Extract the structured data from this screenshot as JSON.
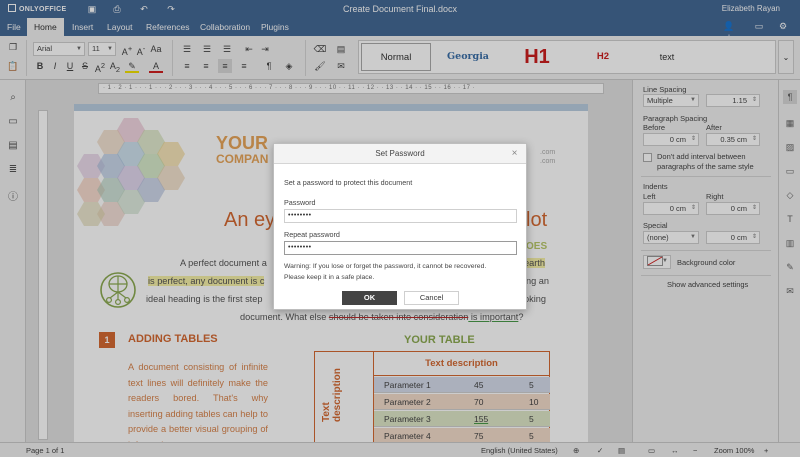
{
  "app": {
    "logo": "ONLYOFFICE",
    "doc_title": "Create Document Final.docx",
    "user": "Elizabeth Rayan"
  },
  "tabs": [
    {
      "label": "File"
    },
    {
      "label": "Home"
    },
    {
      "label": "Insert"
    },
    {
      "label": "Layout"
    },
    {
      "label": "References"
    },
    {
      "label": "Collaboration"
    },
    {
      "label": "Plugins"
    }
  ],
  "toolbar": {
    "font_name": "Arial",
    "font_size": "11",
    "bold": "B",
    "italic": "I",
    "underline": "U",
    "strike": "S",
    "superscript": "A",
    "subscript": "A",
    "font_color": "A"
  },
  "styles": [
    {
      "label": "Normal"
    },
    {
      "label": "Georgia"
    },
    {
      "label": "H1"
    },
    {
      "label": "H2"
    },
    {
      "label": "text"
    }
  ],
  "ruler": {
    "numbers": "· 1 · 2 · 1 · · · 1 · · · 2 · · · 3 · · · 4 · · · 5 · · · 6 · · · 7 · · · 8 · · · 9 · · · 10 · · 11 · · 12 · · 13 · · 14 · · 15 · · 16 · · 17 ·"
  },
  "document": {
    "company_l1": "YOUR",
    "company_l2": "COMPAN",
    "contact_l1": ".com",
    "contact_l2": ".com",
    "heading_left": "An ey",
    "heading_right": "lot",
    "oes": "OES",
    "p1_a": "A perfect document a",
    "p1_b": "earth",
    "p2_a": "is perfect, any document is c",
    "p2_b": "ng an",
    "p3_a": "ideal heading is the first step",
    "p3_b": "oking",
    "p4_a": "document. What else ",
    "p4_strike": "should be taken into consideration",
    "p4_b": " is important",
    "p4_c": "?",
    "section_number": "1",
    "section_title": "ADDING TABLES",
    "section_text": "A document consisting of infinite text lines will definitely make the readers bored. That's why inserting adding tables can help to provide a better visual grouping of information.",
    "table_title": "YOUR TABLE",
    "table_header": "Text description",
    "table_side": "Text description",
    "rows": [
      {
        "name": "Parameter 1",
        "v1": "45",
        "v2": "5"
      },
      {
        "name": "Parameter 2",
        "v1": "70",
        "v2": "10"
      },
      {
        "name": "Parameter 3",
        "v1": "155",
        "v2": "5"
      },
      {
        "name": "Parameter 4",
        "v1": "75",
        "v2": "5"
      }
    ]
  },
  "right_panel": {
    "line_spacing_label": "Line Spacing",
    "line_spacing_mode": "Multiple",
    "line_spacing_value": "1.15",
    "paragraph_spacing_label": "Paragraph Spacing",
    "before_label": "Before",
    "after_label": "After",
    "before_value": "0 cm",
    "after_value": "0.35 cm",
    "dont_add_label_1": "Don't add interval between",
    "dont_add_label_2": "paragraphs of the same style",
    "indents_label": "Indents",
    "left_label": "Left",
    "right_label": "Right",
    "left_value": "0 cm",
    "right_value": "0 cm",
    "special_label": "Special",
    "special_mode": "(none)",
    "special_value": "0 cm",
    "background_color_label": "Background color",
    "show_advanced": "Show advanced settings"
  },
  "statusbar": {
    "page": "Page 1 of 1",
    "language": "English (United States)",
    "zoom": "Zoom 100%"
  },
  "dialog": {
    "title": "Set Password",
    "intro": "Set a password to protect this document",
    "password_label": "Password",
    "password_value": "••••••••",
    "repeat_label": "Repeat password",
    "repeat_value": "••••••••",
    "warning_1": "Warning: If you lose or forget the password, it cannot be recovered.",
    "warning_2": "Please keep it in a safe place.",
    "ok_label": "OK",
    "cancel_label": "Cancel"
  },
  "colors": {
    "header": "#446995",
    "accent_orange": "#d56a32",
    "accent_green": "#8cab52"
  }
}
